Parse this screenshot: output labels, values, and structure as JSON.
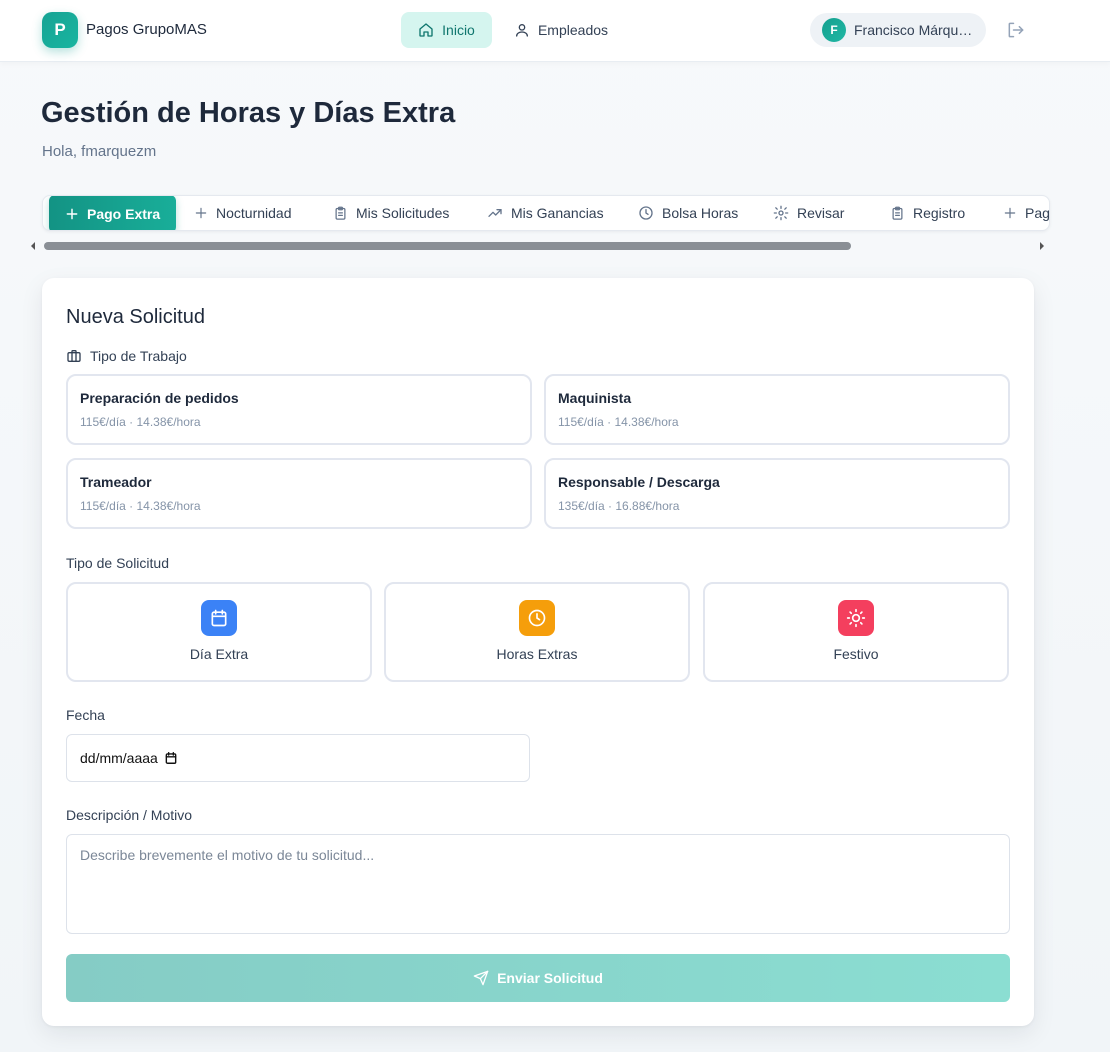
{
  "header": {
    "logo_letter": "P",
    "app_name": "Pagos GrupoMAS",
    "nav": [
      {
        "label": "Inicio",
        "icon": "home-icon",
        "active": true
      },
      {
        "label": "Empleados",
        "icon": "user-icon",
        "active": false
      }
    ],
    "user": {
      "initial": "F",
      "name": "Francisco Márquez Muñoz"
    },
    "logout_icon": "logout-icon"
  },
  "page": {
    "title": "Gestión de Horas y Días Extra",
    "greeting": "Hola, fmarquezm"
  },
  "tabs": [
    {
      "label": "Pago Extra",
      "icon": "plus-icon",
      "active": true
    },
    {
      "label": "Nocturnidad",
      "icon": "plus-icon",
      "active": false
    },
    {
      "label": "Mis Solicitudes",
      "icon": "clipboard-icon",
      "active": false
    },
    {
      "label": "Mis Ganancias",
      "icon": "trending-up-icon",
      "active": false
    },
    {
      "label": "Bolsa Horas",
      "icon": "clock-icon",
      "active": false
    },
    {
      "label": "Revisar",
      "icon": "gear-icon",
      "active": false
    },
    {
      "label": "Registro",
      "icon": "clipboard-icon",
      "active": false
    },
    {
      "label": "Pag",
      "icon": "plus-icon",
      "active": false
    }
  ],
  "form": {
    "title": "Nueva Solicitud",
    "work_type_label": "Tipo de Trabajo",
    "work_types": [
      {
        "name": "Preparación de pedidos",
        "rate": "115€/día · 14.38€/hora"
      },
      {
        "name": "Maquinista",
        "rate": "115€/día · 14.38€/hora"
      },
      {
        "name": "Trameador",
        "rate": "115€/día · 14.38€/hora"
      },
      {
        "name": "Responsable / Descarga",
        "rate": "135€/día · 16.88€/hora"
      }
    ],
    "request_type_label": "Tipo de Solicitud",
    "request_types": [
      {
        "label": "Día Extra",
        "icon": "calendar-icon",
        "color": "#3b82f6"
      },
      {
        "label": "Horas Extras",
        "icon": "clock-icon",
        "color": "#f59e0b"
      },
      {
        "label": "Festivo",
        "icon": "sun-icon",
        "color": "#f43f5e"
      }
    ],
    "date_label": "Fecha",
    "date_placeholder": "dd/mm/aaaa",
    "description_label": "Descripción / Motivo",
    "description_placeholder": "Describe brevemente el motivo de tu solicitud...",
    "submit_label": "Enviar Solicitud"
  },
  "colors": {
    "accent": "#14a08f",
    "accent_light": "#d5f5ef",
    "submit_disabled": "#85ccc5"
  }
}
